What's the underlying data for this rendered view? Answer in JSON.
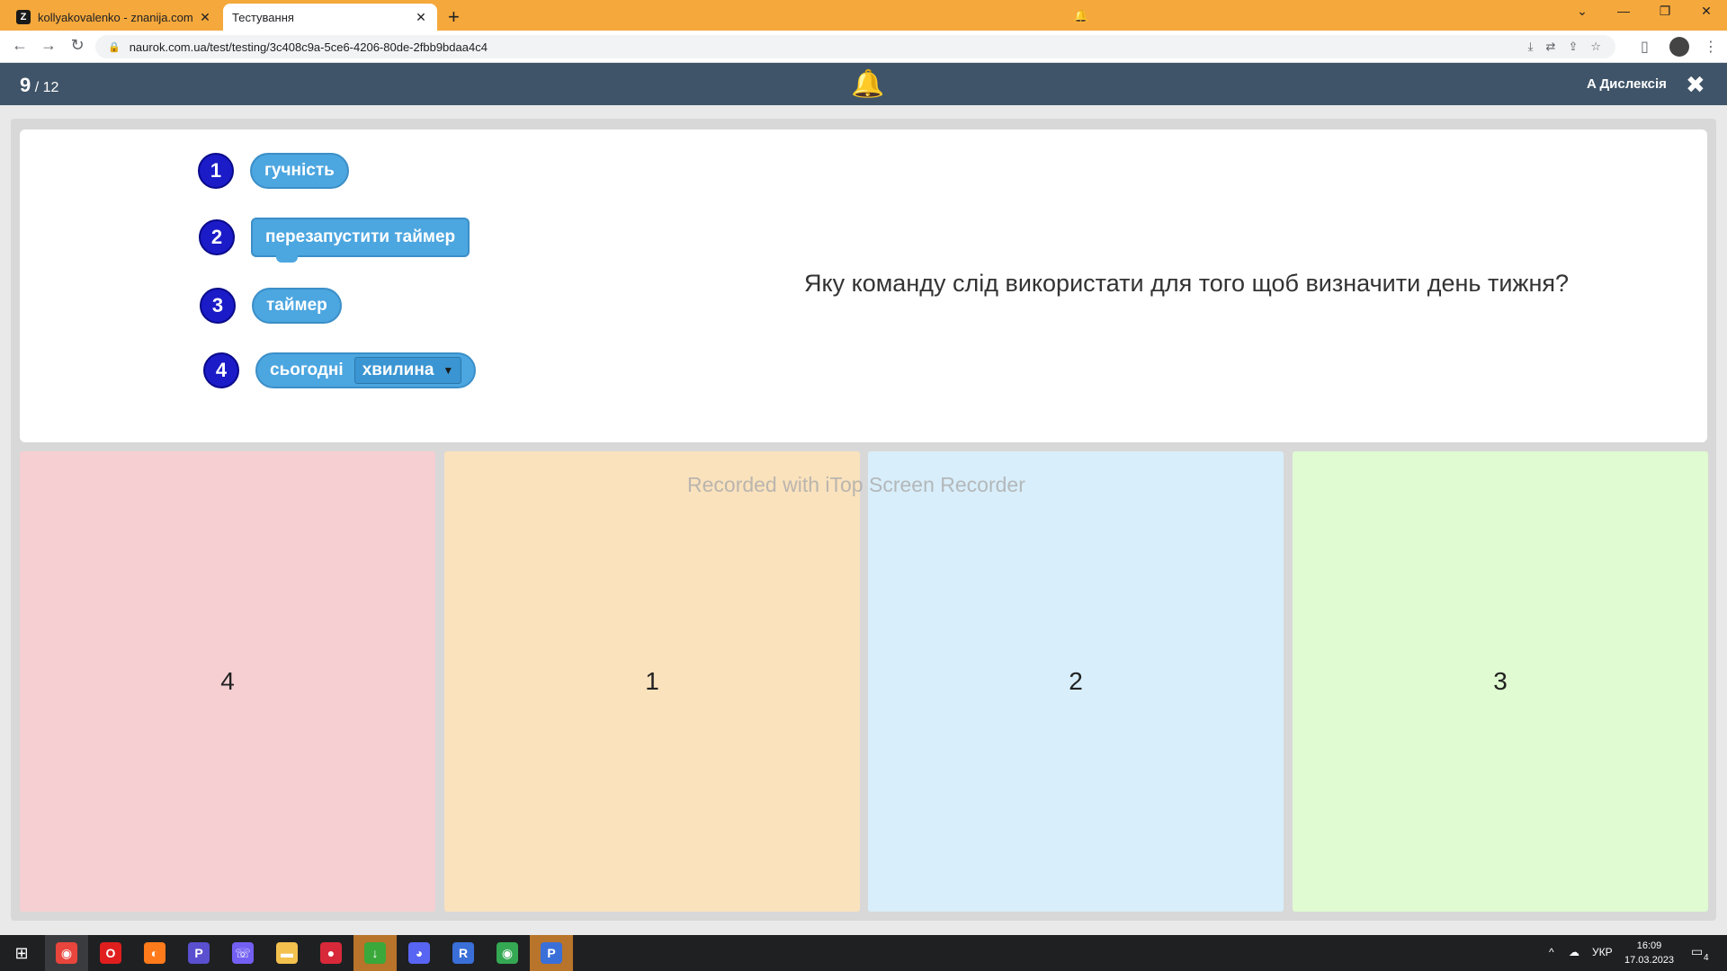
{
  "browser": {
    "tabs": [
      {
        "favicon": "Z",
        "title": "kollyakovalenko - znanija.com",
        "close": "✕"
      },
      {
        "favicon": "🔔",
        "title": "Тестування",
        "close": "✕"
      }
    ],
    "new_tab": "+",
    "url": "naurok.com.ua/test/testing/3c408c9a-5ce6-4206-80de-2fbb9bdaa4c4",
    "window_controls": [
      "⌄",
      "—",
      "❐",
      "✕"
    ],
    "nav": {
      "back": "←",
      "forward": "→",
      "reload": "↻"
    },
    "omni_icons": [
      "⤓",
      "⇄",
      "⇪",
      "☆"
    ],
    "toolbar_icons": [
      "▯",
      "⋮"
    ]
  },
  "app": {
    "progress_current": "9",
    "progress_total": "/ 12",
    "bell_icon": "🔔",
    "dyslexia_label": "A Дислексія",
    "close_label": "✖"
  },
  "question": {
    "text": "Яку команду слід використати для того щоб визначити день тижня?",
    "blocks": [
      {
        "num": "1",
        "label": "гучність"
      },
      {
        "num": "2",
        "label": "перезапустити таймер"
      },
      {
        "num": "3",
        "label": "таймер"
      },
      {
        "num": "4",
        "label": "сьогодні",
        "dropdown": "хвилина",
        "caret": "▼"
      }
    ]
  },
  "answers": [
    {
      "label": "4",
      "color": "#f6cfd2"
    },
    {
      "label": "1",
      "color": "#fae2bd"
    },
    {
      "label": "2",
      "color": "#d8eefa"
    },
    {
      "label": "3",
      "color": "#e0fbd1"
    }
  ],
  "watermark": "Recorded with iTop Screen Recorder",
  "taskbar": {
    "start_icon": "⊞",
    "apps": [
      {
        "name": "chrome-icon",
        "glyph": "◉",
        "color": "#e8453c"
      },
      {
        "name": "opera-icon",
        "glyph": "O",
        "color": "#e01e1e"
      },
      {
        "name": "firefox-icon",
        "glyph": "◐",
        "color": "#ff7a1a"
      },
      {
        "name": "p-app-icon",
        "glyph": "P",
        "color": "#5a4fcf"
      },
      {
        "name": "viber-icon",
        "glyph": "☏",
        "color": "#7360f2"
      },
      {
        "name": "folder-icon",
        "glyph": "▬",
        "color": "#f2c14e"
      },
      {
        "name": "recorder-icon",
        "glyph": "●",
        "color": "#d8293a"
      },
      {
        "name": "green-app-icon",
        "glyph": "↓",
        "color": "#3aa83a"
      },
      {
        "name": "discord-icon",
        "glyph": "◕",
        "color": "#5865f2"
      },
      {
        "name": "r-app-icon",
        "glyph": "R",
        "color": "#3a6fd8"
      },
      {
        "name": "chrome-2-icon",
        "glyph": "◉",
        "color": "#34a853"
      },
      {
        "name": "p-app-2-icon",
        "glyph": "P",
        "color": "#3a6fd8"
      }
    ],
    "tray_caret": "^",
    "language": "УКР",
    "time": "16:09",
    "date": "17.03.2023",
    "notifications": "4"
  }
}
